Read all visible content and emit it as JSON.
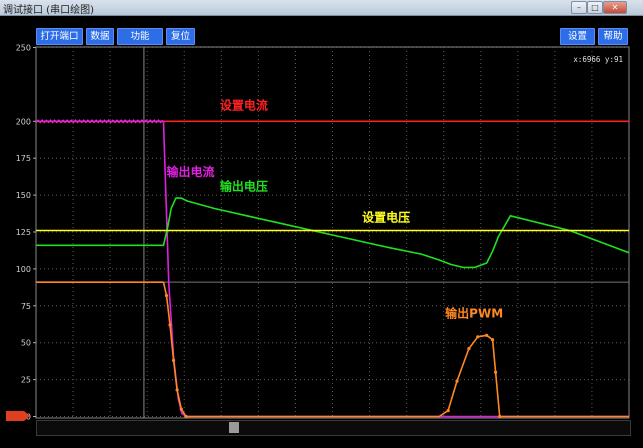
{
  "window": {
    "title": "调试接口 (串口绘图)"
  },
  "toolbar": {
    "left": [
      "打开端口",
      "数据",
      "功能",
      "复位"
    ],
    "right": [
      "设置",
      "帮助"
    ],
    "accent": "#2d6ee8"
  },
  "readout": "x:6966 y:91",
  "chart_data": {
    "type": "line",
    "ylim": [
      0,
      250
    ],
    "yticks": [
      0,
      25,
      50,
      75,
      100,
      125,
      150,
      175,
      200,
      250
    ],
    "grid": true,
    "xlim": [
      0,
      100
    ],
    "cursor_x": 18.2,
    "series": [
      {
        "name": "设置电流",
        "color": "#ff2020",
        "x": [
          0,
          100
        ],
        "values": [
          200,
          200
        ]
      },
      {
        "name": "输出电流",
        "color": "#e020e0",
        "x": [
          0,
          21.5,
          21.9,
          22.4,
          23.2,
          24.0,
          24.6,
          25.5,
          30,
          100
        ],
        "values": [
          200,
          200,
          150,
          90,
          40,
          12,
          2,
          0,
          0,
          0
        ]
      },
      {
        "name": "输出电压",
        "color": "#20e020",
        "x": [
          0,
          21.5,
          22.2,
          22.8,
          23.6,
          24.5,
          25.5,
          30,
          40,
          50,
          60,
          65,
          68,
          70,
          72,
          74,
          76,
          77,
          78,
          80,
          90,
          100
        ],
        "values": [
          116,
          116,
          128,
          141,
          148,
          148,
          146,
          141,
          132,
          123,
          114,
          110,
          106,
          103,
          101,
          101,
          104,
          112,
          122,
          136,
          126,
          111
        ]
      },
      {
        "name": "设置电压",
        "color": "#ffff20",
        "x": [
          0,
          100
        ],
        "values": [
          126,
          126
        ]
      },
      {
        "name": "输出PWM",
        "color": "#ff8820",
        "x": [
          0,
          21.5,
          22.0,
          22.6,
          23.2,
          23.8,
          24.5,
          25.3,
          26,
          68,
          69.5,
          71,
          73,
          74.5,
          76,
          77,
          77.5,
          78.2,
          100
        ],
        "values": [
          91,
          91,
          82,
          62,
          38,
          18,
          5,
          0,
          0,
          0,
          4,
          24,
          46,
          54,
          55,
          52,
          30,
          0,
          0
        ]
      }
    ],
    "annotations": [
      {
        "text": "设置电流",
        "color": "#ff2020",
        "x": 31,
        "y": 208
      },
      {
        "text": "输出电流",
        "color": "#e020e0",
        "x": 22,
        "y": 163
      },
      {
        "text": "输出电压",
        "color": "#20e020",
        "x": 31,
        "y": 153
      },
      {
        "text": "设置电压",
        "color": "#ffff20",
        "x": 55,
        "y": 132
      },
      {
        "text": "输出PWM",
        "color": "#ff8820",
        "x": 69,
        "y": 67
      }
    ]
  },
  "scroll": {
    "position": 0.33
  }
}
